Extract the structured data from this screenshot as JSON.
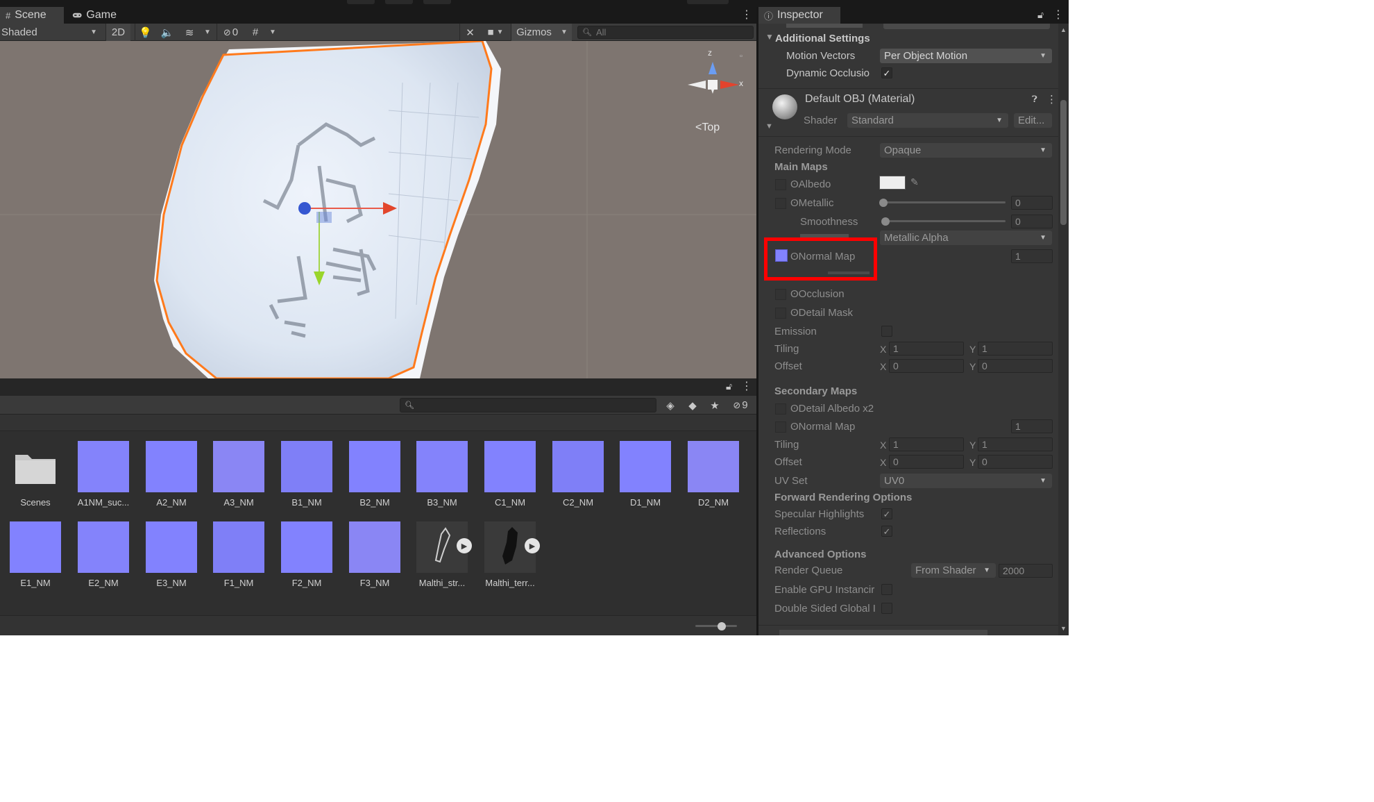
{
  "scene_panel": {
    "tabs": [
      {
        "label": "Scene",
        "icon": "grid-icon"
      },
      {
        "label": "Game",
        "icon": "gamepad-icon"
      }
    ],
    "toolbar": {
      "draw_mode": "Shaded",
      "toggle_2d": "2D",
      "hidden_count": "0",
      "gizmos_label": "Gizmos",
      "search_placeholder": "All"
    },
    "orientation_label": "Top",
    "axis_labels": {
      "y": "z",
      "x": "x"
    }
  },
  "project_panel": {
    "hidden_count": "9",
    "assets_row1": [
      {
        "name": "Scenes",
        "kind": "folder"
      },
      {
        "name": "A1NM_suc...",
        "kind": "normal-map"
      },
      {
        "name": "A2_NM",
        "kind": "normal-map"
      },
      {
        "name": "A3_NM",
        "kind": "normal-map"
      },
      {
        "name": "B1_NM",
        "kind": "normal-map"
      },
      {
        "name": "B2_NM",
        "kind": "normal-map"
      },
      {
        "name": "B3_NM",
        "kind": "normal-map"
      },
      {
        "name": "C1_NM",
        "kind": "normal-map"
      },
      {
        "name": "C2_NM",
        "kind": "normal-map"
      },
      {
        "name": "D1_NM",
        "kind": "normal-map"
      },
      {
        "name": "D2_NM",
        "kind": "normal-map"
      }
    ],
    "assets_row2": [
      {
        "name": "E1_NM",
        "kind": "normal-map"
      },
      {
        "name": "E2_NM",
        "kind": "normal-map"
      },
      {
        "name": "E3_NM",
        "kind": "normal-map"
      },
      {
        "name": "F1_NM",
        "kind": "normal-map"
      },
      {
        "name": "F2_NM",
        "kind": "normal-map"
      },
      {
        "name": "F3_NM",
        "kind": "normal-map"
      },
      {
        "name": "Malthi_str...",
        "kind": "model"
      },
      {
        "name": "Malthi_terr...",
        "kind": "model"
      }
    ]
  },
  "inspector": {
    "tab_label": "Inspector",
    "additional_settings": {
      "header": "Additional Settings",
      "motion_vectors_label": "Motion Vectors",
      "motion_vectors_value": "Per Object Motion",
      "dynamic_occlusion_label": "Dynamic Occlusio",
      "dynamic_occlusion_checked": "✓"
    },
    "material": {
      "title": "Default OBJ (Material)",
      "shader_label": "Shader",
      "shader_value": "Standard",
      "edit_label": "Edit..."
    },
    "properties": {
      "rendering_mode_label": "Rendering Mode",
      "rendering_mode_value": "Opaque",
      "main_maps": "Main Maps",
      "albedo": "Albedo",
      "metallic": "Metallic",
      "metallic_value": "0",
      "smoothness": "Smoothness",
      "smoothness_value": "0",
      "source_value": "Metallic Alpha",
      "normal_map": "Normal Map",
      "normal_map_value": "1",
      "occlusion": "Occlusion",
      "detail_mask": "Detail Mask",
      "emission": "Emission",
      "tiling": "Tiling",
      "offset": "Offset",
      "tiling_x": "1",
      "tiling_y": "1",
      "offset_x": "0",
      "offset_y": "0",
      "secondary_maps": "Secondary Maps",
      "detail_albedo": "Detail Albedo x2",
      "secondary_normal_map": "Normal Map",
      "secondary_normal_value": "1",
      "sec_tiling_x": "1",
      "sec_tiling_y": "1",
      "sec_offset_x": "0",
      "sec_offset_y": "0",
      "uv_set_label": "UV Set",
      "uv_set_value": "UV0",
      "forward_rendering": "Forward Rendering Options",
      "specular_highlights": "Specular Highlights",
      "reflections": "Reflections",
      "advanced_options": "Advanced Options",
      "render_queue_label": "Render Queue",
      "render_queue_mode": "From Shader",
      "render_queue_value": "2000",
      "gpu_instancing": "Enable GPU Instancir",
      "double_sided": "Double Sided Global I",
      "x_label": "X",
      "y_label": "Y"
    }
  },
  "colors": {
    "normal_map": "#8282fe",
    "highlight": "#ff0000",
    "selection_outline": "#ff7a1c",
    "viewport_bg": "#7e7570"
  }
}
